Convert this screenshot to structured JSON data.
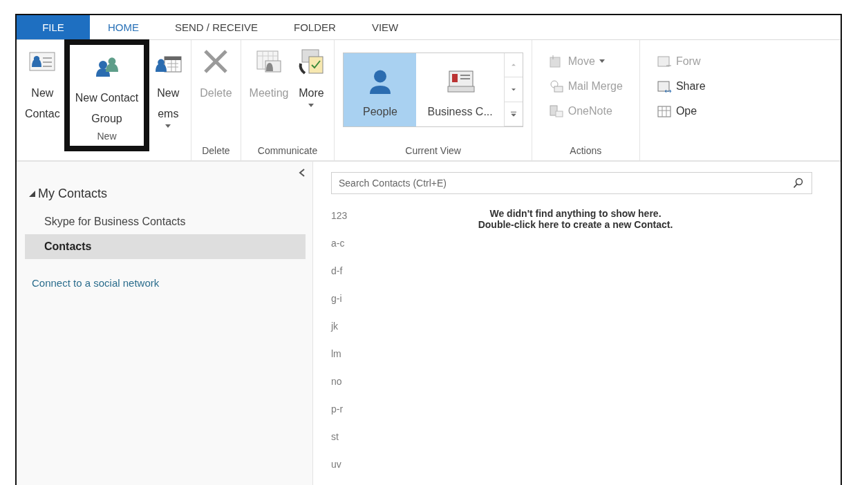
{
  "tabs": [
    {
      "label": "FILE",
      "kind": "backstage",
      "selected": false
    },
    {
      "label": "HOME",
      "kind": "tab",
      "selected": true
    },
    {
      "label": "SEND / RECEIVE",
      "kind": "tab",
      "selected": false
    },
    {
      "label": "FOLDER",
      "kind": "tab",
      "selected": false
    },
    {
      "label": "VIEW",
      "kind": "tab",
      "selected": false
    }
  ],
  "ribbon": {
    "groups": [
      {
        "label": "New",
        "kind": "large",
        "buttons": [
          {
            "lines": [
              "New",
              "Contac"
            ],
            "disabled": false,
            "dropdown": false,
            "highlighted": false
          },
          {
            "lines": [
              "New Contact",
              "Group"
            ],
            "disabled": false,
            "dropdown": false,
            "highlighted": true
          },
          {
            "lines": [
              "New",
              "ems"
            ],
            "disabled": false,
            "dropdown": true,
            "highlighted": false
          }
        ]
      },
      {
        "label": "Delete",
        "kind": "large",
        "buttons": [
          {
            "lines": [
              "Delete"
            ],
            "disabled": true,
            "dropdown": false,
            "highlighted": false
          }
        ]
      },
      {
        "label": "Communicate",
        "kind": "large",
        "buttons": [
          {
            "lines": [
              "Meeting"
            ],
            "disabled": true,
            "dropdown": false,
            "highlighted": false
          },
          {
            "lines": [
              "More"
            ],
            "disabled": false,
            "dropdown": true,
            "highlighted": false
          }
        ]
      },
      {
        "label": "Current View",
        "kind": "gallery",
        "items": [
          {
            "label": "People",
            "selected": true
          },
          {
            "label": "Business C...",
            "selected": false
          }
        ]
      },
      {
        "label": "Actions",
        "kind": "small",
        "buttons": [
          {
            "label": "Move",
            "disabled": true,
            "dropdown": true
          },
          {
            "label": "Mail Merge",
            "disabled": true,
            "dropdown": false
          },
          {
            "label": "OneNote",
            "disabled": true,
            "dropdown": false
          }
        ]
      },
      {
        "kind": "small",
        "buttons": [
          {
            "label": "Forw",
            "disabled": true,
            "dropdown": false
          },
          {
            "label": "Share",
            "disabled": false,
            "dropdown": false
          },
          {
            "label": "Ope",
            "disabled": false,
            "dropdown": false
          }
        ]
      }
    ]
  },
  "sidebar": {
    "header": {
      "label": "My Contacts",
      "expanded": true
    },
    "items": [
      {
        "label": "Skype for Business Contacts",
        "selected": false
      },
      {
        "label": "Contacts",
        "selected": true
      }
    ],
    "link": "Connect to a social network"
  },
  "search": {
    "placeholder": "Search Contacts (Ctrl+E)"
  },
  "index": [
    "123",
    "a-c",
    "d-f",
    "g-i",
    "jk",
    "lm",
    "no",
    "p-r",
    "st",
    "uv"
  ],
  "empty_message": [
    "We didn't find anything to show here.",
    "Double-click here to create a new Contact."
  ]
}
